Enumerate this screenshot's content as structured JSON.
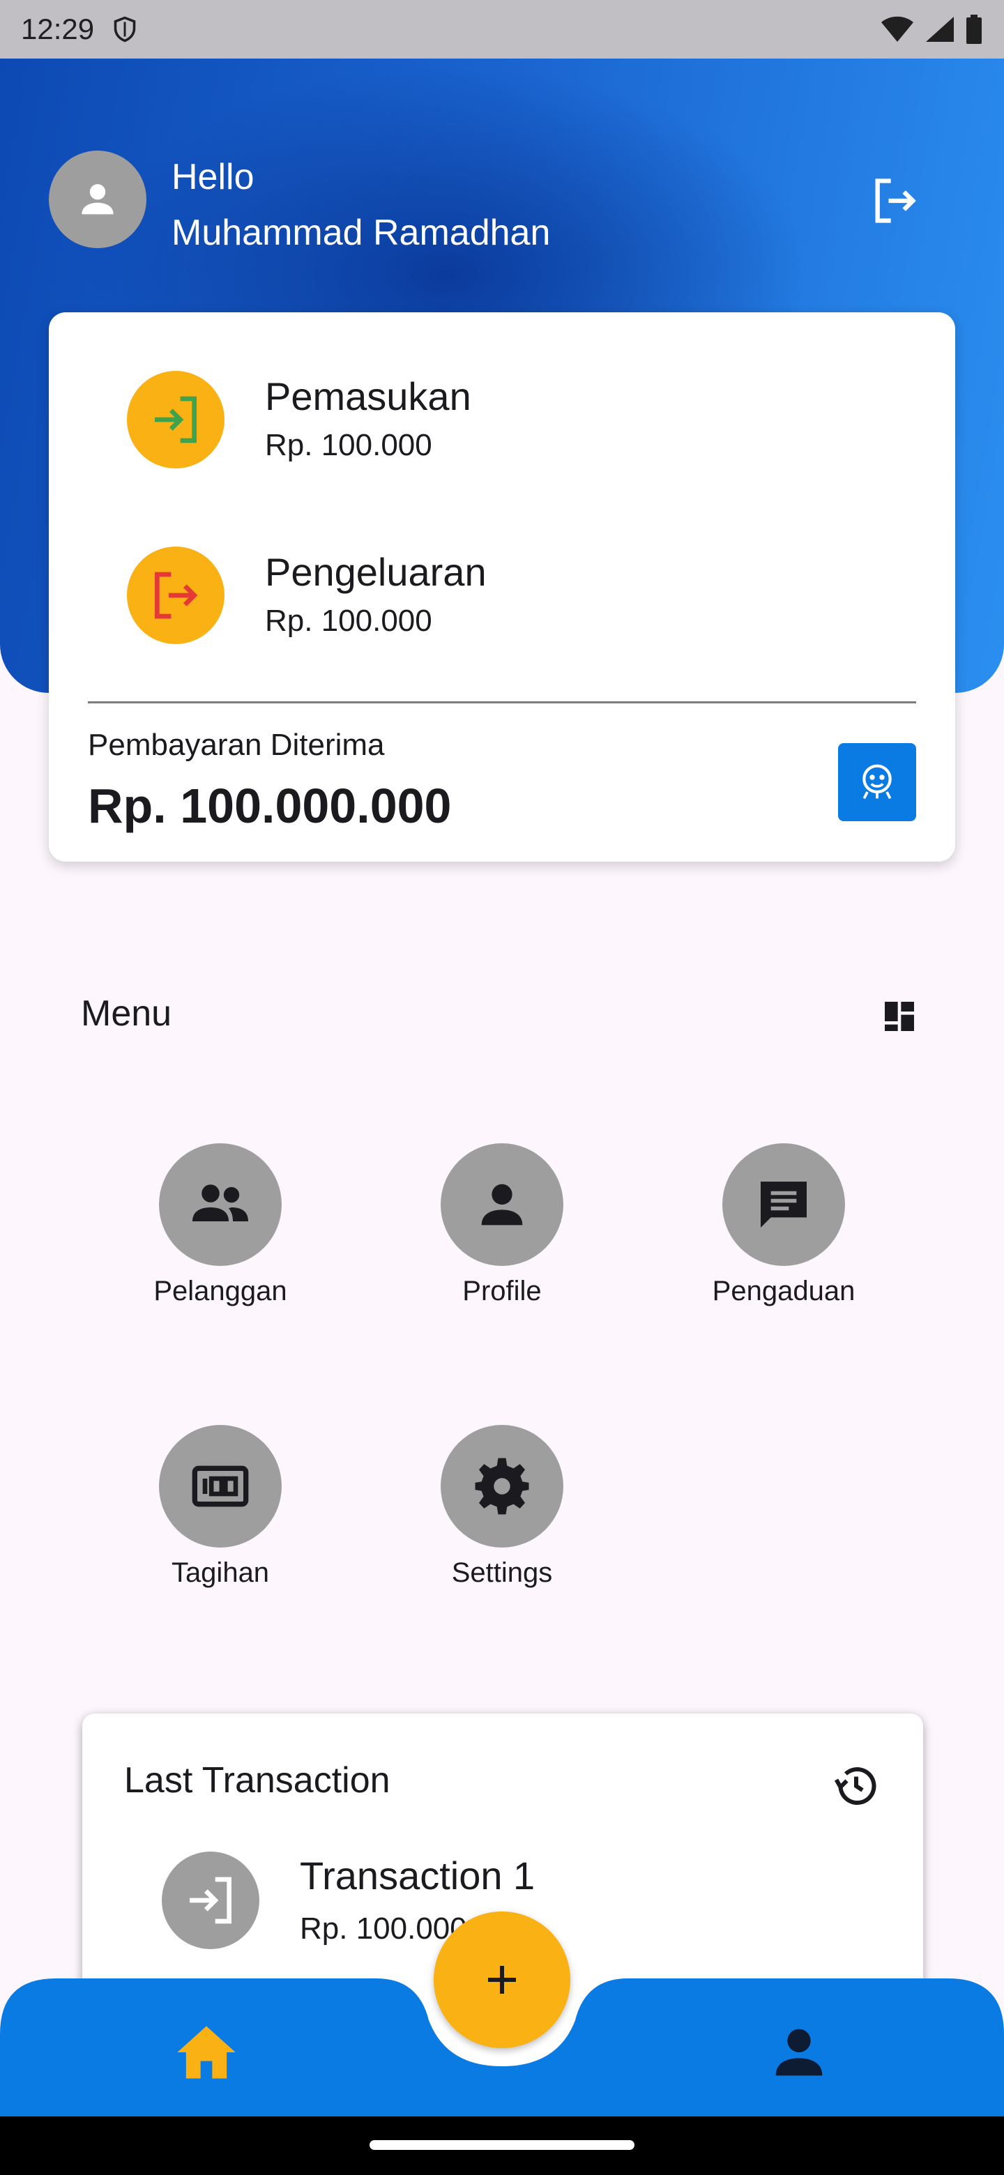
{
  "status_bar": {
    "time": "12:29",
    "icons": [
      "shield-icon",
      "wifi-icon",
      "signal-icon",
      "battery-icon"
    ]
  },
  "header": {
    "greeting": "Hello",
    "user_name": "Muhammad Ramadhan",
    "icons": [
      "avatar-person-icon",
      "logout-icon"
    ]
  },
  "summary": {
    "income": {
      "label": "Pemasukan",
      "value": "Rp. 100.000",
      "icon": "login-icon",
      "icon_color": "#3fa34d"
    },
    "expense": {
      "label": "Pengeluaran",
      "value": "Rp. 100.000",
      "icon": "logout-icon",
      "icon_color": "#e53935"
    },
    "payment_label": "Pembayaran Diterima",
    "payment_amount": "Rp. 100.000.000",
    "payment_button_icon": "face-scan-icon"
  },
  "menu": {
    "title": "Menu",
    "header_icon": "dashboard-grid-icon",
    "items": [
      {
        "label": "Pelanggan",
        "icon": "people-icon"
      },
      {
        "label": "Profile",
        "icon": "person-icon"
      },
      {
        "label": "Pengaduan",
        "icon": "chat-icon"
      },
      {
        "label": "Tagihan",
        "icon": "money-100-icon"
      },
      {
        "label": "Settings",
        "icon": "gear-icon"
      }
    ]
  },
  "last_transaction": {
    "title": "Last Transaction",
    "header_icon": "history-icon",
    "items": [
      {
        "title": "Transaction 1",
        "value": "Rp. 100.000",
        "icon": "login-icon"
      }
    ]
  },
  "bottom_nav": {
    "items": [
      {
        "icon": "home-icon",
        "active": true
      },
      {
        "icon": "person-icon",
        "active": false
      }
    ],
    "fab_icon": "plus-icon"
  },
  "colors": {
    "primary_blue": "#0b7be4",
    "accent_yellow": "#f9b114",
    "icon_grey": "#9e9e9e",
    "background": "#fdf7fd"
  }
}
